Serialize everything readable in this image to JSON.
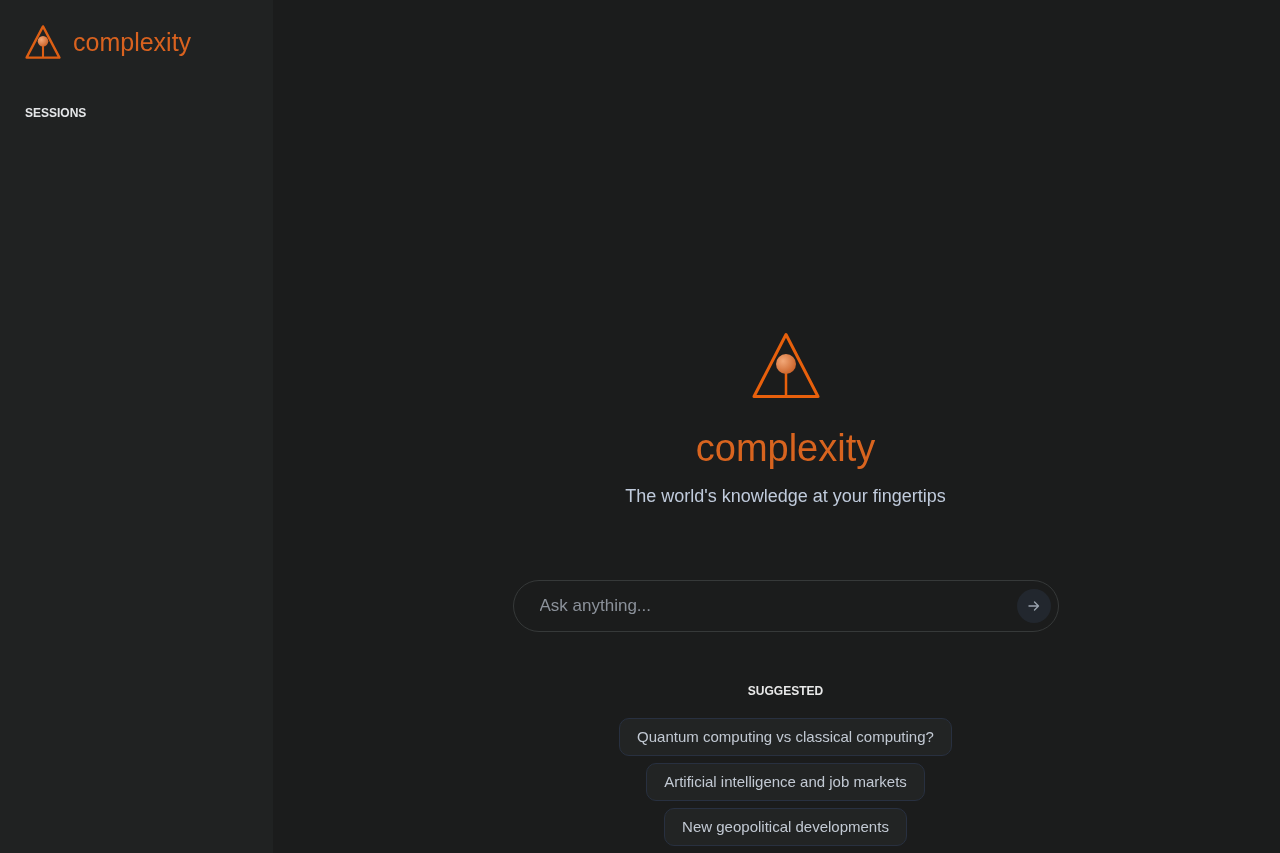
{
  "sidebar": {
    "brand": {
      "name": "complexity"
    },
    "section_heading": "SESSIONS"
  },
  "hero": {
    "brand_name": "complexity",
    "tagline": "The world's knowledge at your fingertips"
  },
  "search": {
    "placeholder": "Ask anything..."
  },
  "suggested": {
    "heading": "SUGGESTED",
    "items": [
      "Quantum computing vs classical computing?",
      "Artificial intelligence and job markets",
      "New geopolitical developments"
    ]
  }
}
